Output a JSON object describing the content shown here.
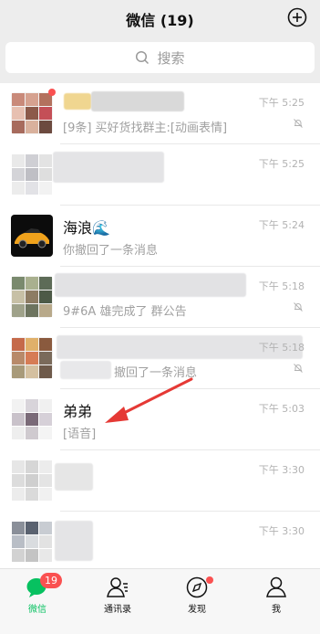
{
  "header": {
    "title": "微信 (19)"
  },
  "search": {
    "placeholder": "搜索"
  },
  "chats": [
    {
      "name": "",
      "preview": "[9条] 买好货找群主:[动画表情]",
      "time": "下午 5:25",
      "muted": true,
      "unread_dot": true
    },
    {
      "name": "",
      "preview": "",
      "time": "下午 5:25",
      "muted": false
    },
    {
      "name": "海浪🌊",
      "preview": "你撤回了一条消息",
      "time": "下午 5:24",
      "muted": false
    },
    {
      "name": "",
      "preview": "9#6A 雄完成了 群公告",
      "time": "下午 5:18",
      "muted": true
    },
    {
      "name": "",
      "preview": "撤回了一条消息",
      "time": "下午 5:18",
      "muted": true
    },
    {
      "name": "弟弟",
      "preview": "[语音]",
      "time": "下午 5:03",
      "muted": false
    },
    {
      "name": "",
      "preview": "",
      "time": "下午 3:30",
      "muted": false
    },
    {
      "name": "",
      "preview": "",
      "time": "下午 3:30",
      "muted": false
    }
  ],
  "tabbar": {
    "tabs": [
      {
        "label": "微信",
        "icon": "chat-bubble-icon",
        "badge": "19",
        "active": true
      },
      {
        "label": "通讯录",
        "icon": "contacts-icon"
      },
      {
        "label": "发现",
        "icon": "compass-icon",
        "dot": true
      },
      {
        "label": "我",
        "icon": "person-icon"
      }
    ]
  },
  "colors": {
    "accent": "#07c160",
    "badge": "#fa5151",
    "annotation_arrow": "#e53935"
  }
}
